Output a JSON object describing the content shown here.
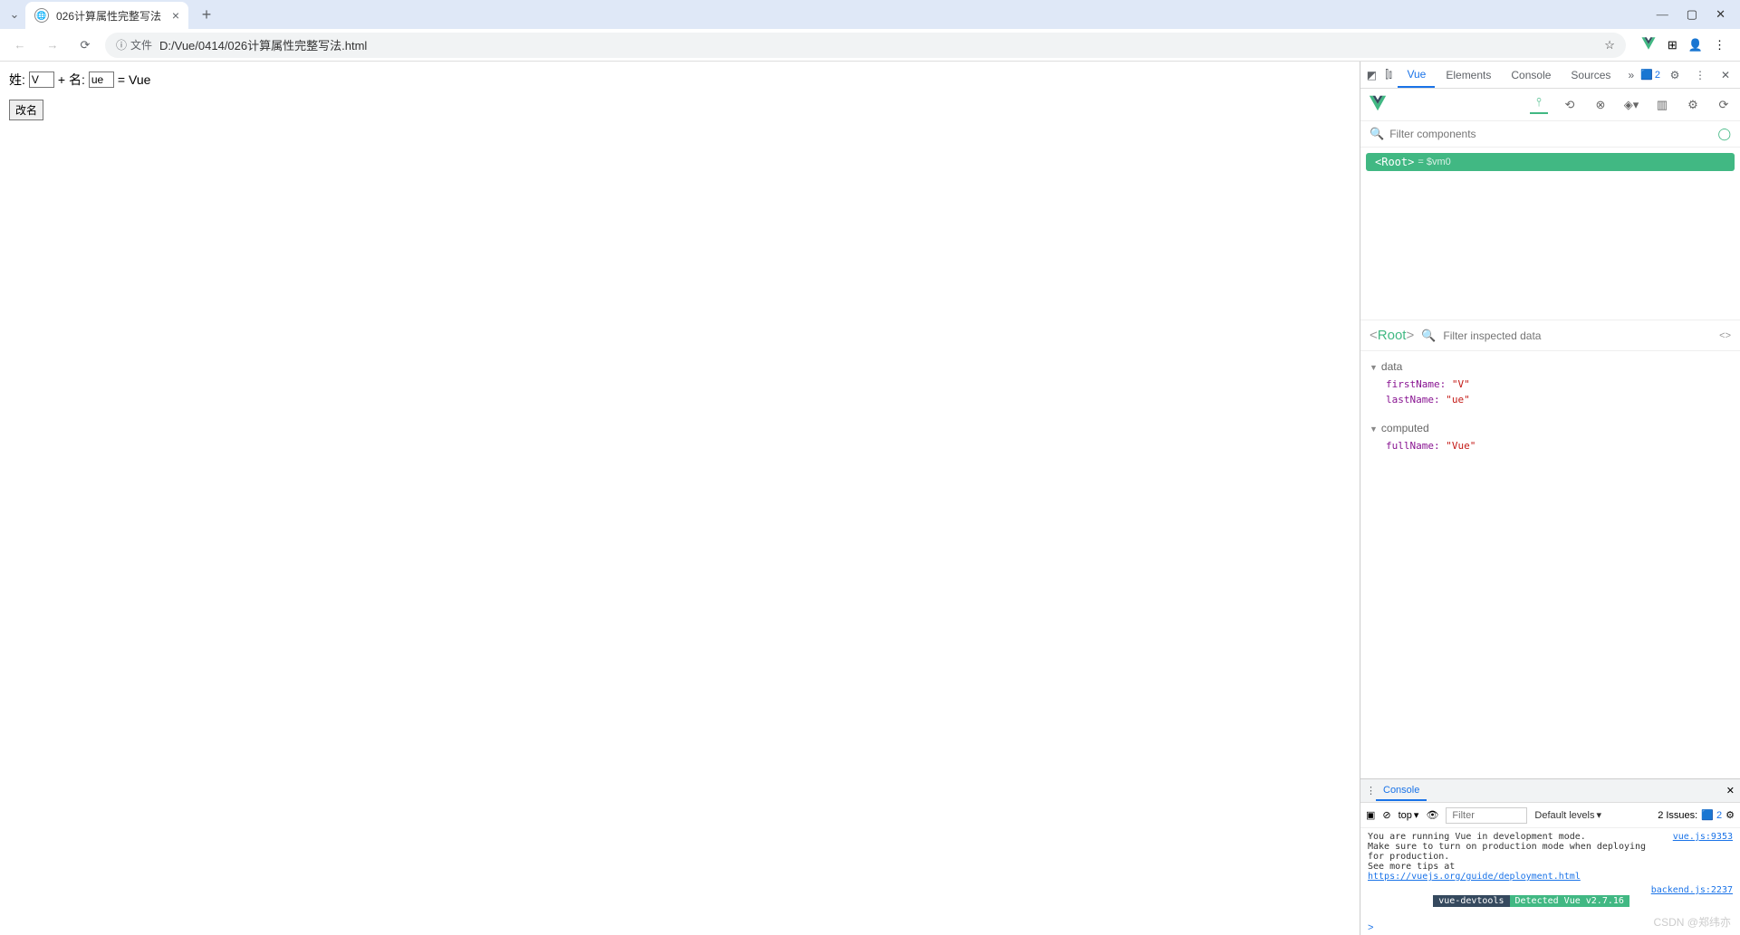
{
  "browser": {
    "tab_title": "026计算属性完整写法",
    "url_label": "文件",
    "url": "D:/Vue/0414/026计算属性完整写法.html"
  },
  "page": {
    "surname_label": "姓:",
    "surname_value": "V",
    "plus_label": "+ 名:",
    "given_value": "ue",
    "equals_label": "=",
    "result": "Vue",
    "button": "改名"
  },
  "devtools": {
    "tabs": [
      "Vue",
      "Elements",
      "Console",
      "Sources"
    ],
    "active_tab": "Vue",
    "issues_count": "2"
  },
  "vue": {
    "filter_placeholder": "Filter components",
    "root_label": "<Root>",
    "root_eq": "= $vm0",
    "inspector": {
      "title": "Root",
      "filter_placeholder": "Filter inspected data"
    },
    "data_section": "data",
    "data_props": {
      "firstName_key": "firstName:",
      "firstName_val": "\"V\"",
      "lastName_key": "lastName:",
      "lastName_val": "\"ue\""
    },
    "computed_section": "computed",
    "computed_props": {
      "fullName_key": "fullName:",
      "fullName_val": "\"Vue\""
    }
  },
  "console": {
    "tab": "Console",
    "context": "top",
    "filter_placeholder": "Filter",
    "levels": "Default levels",
    "issues_label": "2 Issues:",
    "issues_count": "2",
    "msg1": "You are running Vue in development mode.\nMake sure to turn on production mode when deploying for production.\nSee more tips at ",
    "msg1_link": "https://vuejs.org/guide/deployment.html",
    "msg1_src": "vue.js:9353",
    "badge1": "vue-devtools",
    "badge2": "Detected Vue v2.7.16",
    "msg2_src": "backend.js:2237",
    "prompt": ">"
  },
  "watermark": "CSDN @郑纬亦"
}
